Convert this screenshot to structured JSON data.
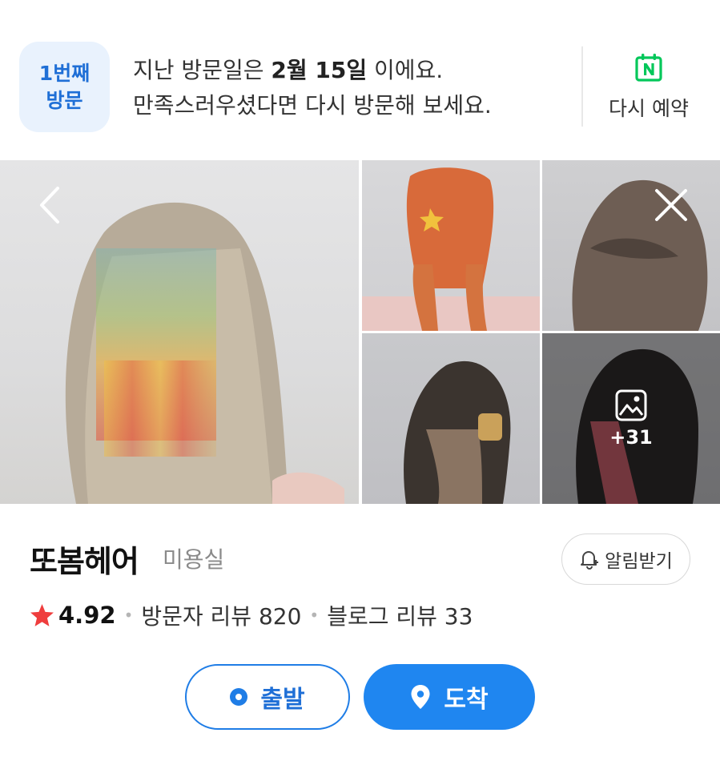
{
  "visit_banner": {
    "badge_line1": "1번째",
    "badge_line2": "방문",
    "text_prefix": "지난 방문일은 ",
    "visit_date": "2월 15일",
    "text_suffix": " 이에요.",
    "text_line2": "만족스러우셨다면 다시 방문해 보세요.",
    "rebook_label": "다시 예약",
    "rebook_icon": "naver-calendar-icon",
    "accent_color": "#03c75a"
  },
  "gallery": {
    "more_count": "+31",
    "back_icon": "chevron-left-icon",
    "close_icon": "close-icon",
    "more_icon": "image-icon"
  },
  "place": {
    "name": "또봄헤어",
    "category": "미용실",
    "alarm_label": "알림받기",
    "rating": "4.92",
    "visitor_reviews": "방문자 리뷰 820",
    "blog_reviews": "블로그 리뷰 33",
    "star_color": "#ef3d3d"
  },
  "route": {
    "depart_label": "출발",
    "arrive_label": "도착",
    "primary_color": "#1f86f0"
  }
}
